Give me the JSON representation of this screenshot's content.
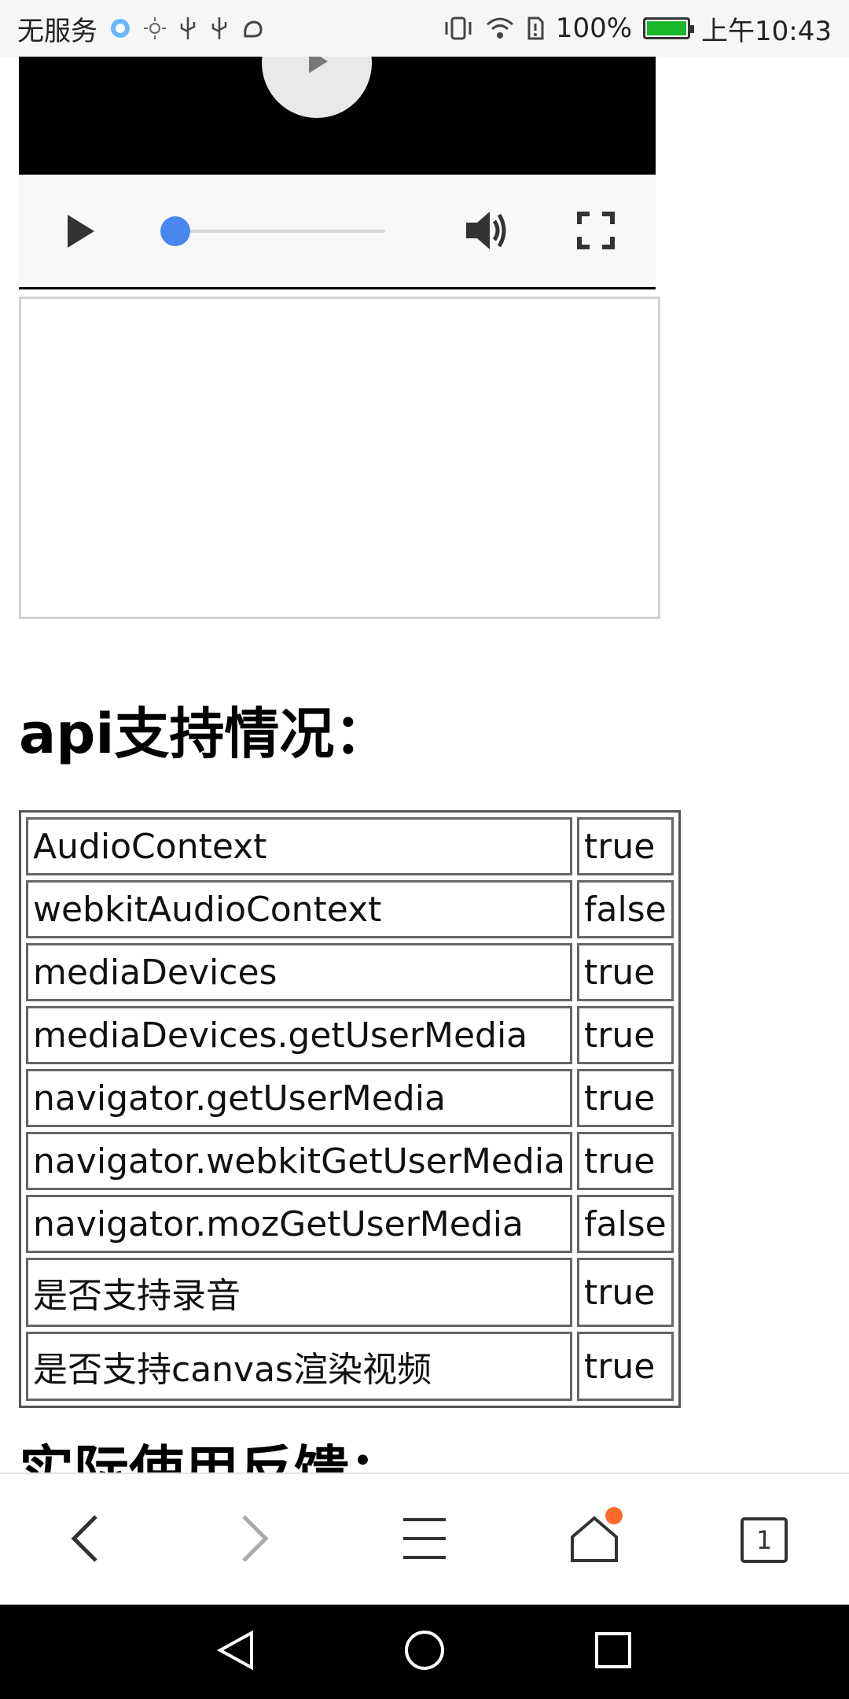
{
  "status_bar": {
    "carrier": "无服务",
    "battery_percent": "100%",
    "time": "上午10:43",
    "icons": [
      "browser-icon",
      "brightness-icon",
      "usb-icon",
      "usb-icon",
      "app-icon",
      "vibrate-icon",
      "wifi-icon",
      "sim-icon",
      "battery-icon"
    ]
  },
  "video_player": {
    "progress": 0.0
  },
  "sections": {
    "api_heading": "api支持情况：",
    "feedback_heading": "实际使用反馈："
  },
  "api_table": [
    {
      "key": "AudioContext",
      "value": "true"
    },
    {
      "key": "webkitAudioContext",
      "value": "false"
    },
    {
      "key": "mediaDevices",
      "value": "true"
    },
    {
      "key": "mediaDevices.getUserMedia",
      "value": "true"
    },
    {
      "key": "navigator.getUserMedia",
      "value": "true"
    },
    {
      "key": "navigator.webkitGetUserMedia",
      "value": "true"
    },
    {
      "key": "navigator.mozGetUserMedia",
      "value": "false"
    },
    {
      "key": "是否支持录音",
      "value": "true"
    },
    {
      "key": "是否支持canvas渲染视频",
      "value": "true"
    }
  ],
  "toolbar": {
    "tabs_count": "1",
    "colors": {
      "badge": "#ff6a2b"
    }
  }
}
